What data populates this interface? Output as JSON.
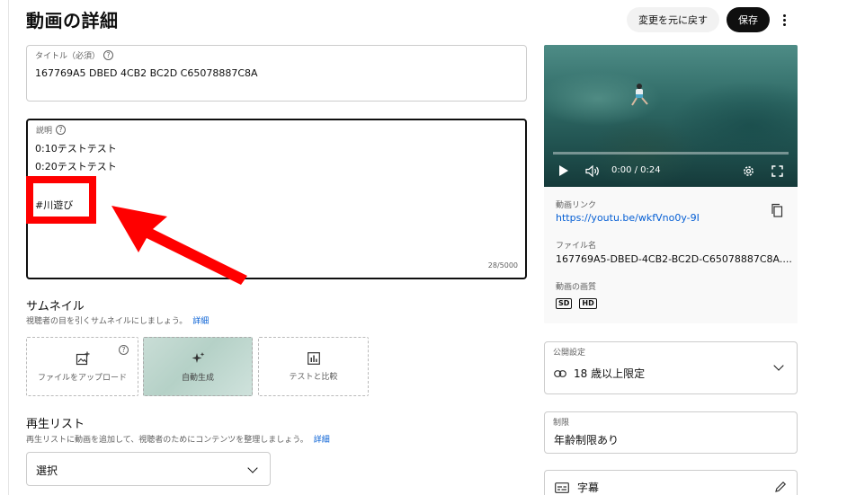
{
  "header": {
    "title": "動画の詳細",
    "undo_label": "変更を元に戻す",
    "save_label": "保存"
  },
  "title_field": {
    "label": "タイトル（必須）",
    "value": "167769A5 DBED 4CB2 BC2D C65078887C8A"
  },
  "description_field": {
    "label": "説明",
    "lines": [
      "0:10テストテスト",
      "0:20テストテスト",
      "",
      "#川遊び"
    ],
    "char_count": "28/5000"
  },
  "thumbnail": {
    "title": "サムネイル",
    "desc": "視聴者の目を引くサムネイルにしましょう。",
    "link": "詳細",
    "options": {
      "upload": "ファイルをアップロード",
      "auto": "自動生成",
      "test": "テストと比較"
    }
  },
  "playlist": {
    "title": "再生リスト",
    "desc": "再生リストに動画を追加して、視聴者のためにコンテンツを整理しましょう。",
    "link": "詳細",
    "select_value": "選択"
  },
  "video_panel": {
    "time": "0:00 / 0:24",
    "link_label": "動画リンク",
    "link_url": "https://youtu.be/wkfVno0y-9I",
    "filename_label": "ファイル名",
    "filename": "167769A5-DBED-4CB2-BC2D-C65078887C8A....",
    "quality_label": "動画の画質",
    "quality_badges": [
      "SD",
      "HD"
    ]
  },
  "visibility": {
    "label": "公開設定",
    "value": "18 歳以上限定"
  },
  "restriction": {
    "label": "制限",
    "value": "年齢制限あり"
  },
  "captions": {
    "label": "字幕"
  },
  "colors": {
    "annotation_red": "#ff0000",
    "link_blue": "#065fd4",
    "primary_dark": "#0f0f0f"
  }
}
